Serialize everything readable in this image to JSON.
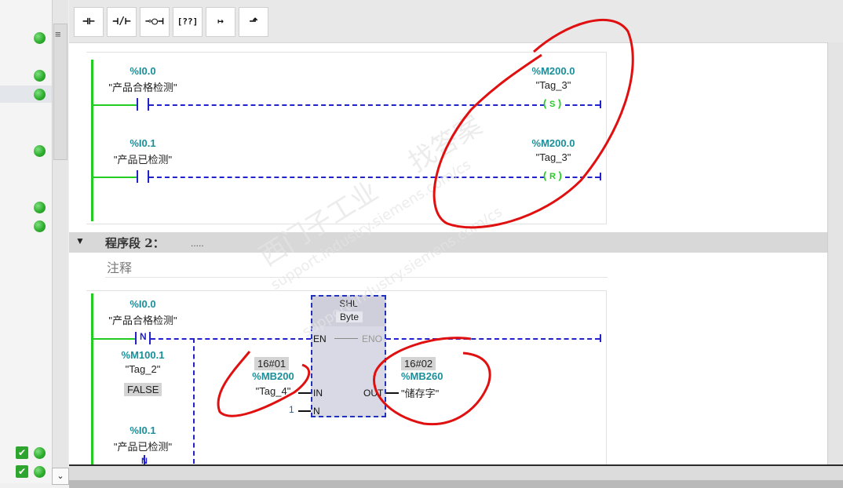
{
  "left_panel": {
    "status_rows": [
      {
        "icon": "status-ok"
      },
      {
        "icon": "status-ok"
      },
      {
        "icon": "status-ok"
      },
      {
        "icon": "status-ok"
      },
      {
        "icon": "status-ok"
      },
      {
        "icon": "status-ok"
      }
    ],
    "bottom_rows": [
      {
        "icon": "checkbox-checked"
      },
      {
        "icon": "checkbox-checked"
      }
    ],
    "menu_icon": "≡",
    "scroll_down_icon": "⌄"
  },
  "toolbar": {
    "buttons": [
      {
        "name": "normally-open-contact",
        "glyph": "⊣⊢"
      },
      {
        "name": "normally-closed-contact",
        "glyph": "⊣/⊢"
      },
      {
        "name": "output-coil",
        "glyph": "⊸○⊣"
      },
      {
        "name": "empty-box",
        "glyph": "[??]"
      },
      {
        "name": "open-branch",
        "glyph": "↦"
      },
      {
        "name": "close-branch",
        "glyph": "⬏"
      }
    ]
  },
  "network1": {
    "contact1": {
      "address": "%I0.0",
      "tag": "\"产品合格检测\""
    },
    "coil1": {
      "address": "%M200.0",
      "tag": "\"Tag_3\"",
      "type": "S"
    },
    "contact2": {
      "address": "%I0.1",
      "tag": "\"产品已检测\""
    },
    "coil2": {
      "address": "%M200.0",
      "tag": "\"Tag_3\"",
      "type": "R"
    }
  },
  "network2": {
    "title": "程序段 2：",
    "title_dots": ".....",
    "comment": "注释",
    "contact": {
      "address": "%I0.0",
      "tag": "\"产品合格检测\"",
      "type": "N"
    },
    "edge_memory": {
      "address": "%M100.1",
      "tag": "\"Tag_2\"",
      "value": "FALSE"
    },
    "contact2": {
      "address": "%I0.1",
      "tag": "\"产品已检测\"",
      "type": "N"
    },
    "shl": {
      "name": "SHL",
      "data_type": "Byte",
      "en": "EN",
      "eno": "ENO",
      "in": "IN",
      "out": "OUT",
      "n": "N",
      "in_value": "16#01",
      "in_address": "%MB200",
      "in_tag": "\"Tag_4\"",
      "n_value": "1",
      "out_value": "16#02",
      "out_address": "%MB260",
      "out_tag": "\"储存字\""
    }
  },
  "watermark": {
    "lines": [
      "西门子工业",
      "support.industry.siemens.com/cs",
      "找答案",
      "support.industry.siemens.com/cs"
    ]
  },
  "colors": {
    "rail": "#22cc22",
    "wire": "#2222cc",
    "operand": "#1a8f9a",
    "annotation": "#e01010"
  }
}
